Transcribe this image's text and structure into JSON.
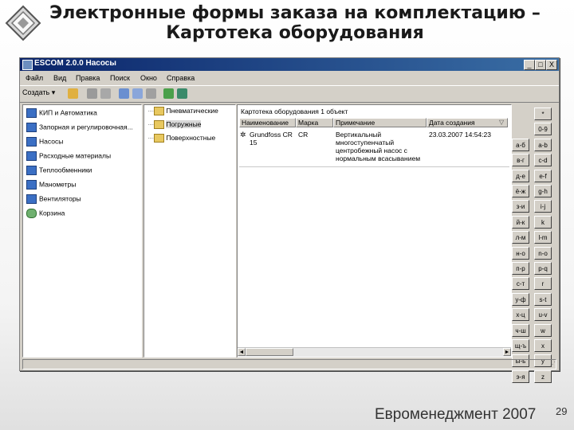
{
  "slide": {
    "title": "Электронные формы заказа на комплектацию – Картотека оборудования",
    "footer": "Евроменеджмент 2007",
    "page_number": "29"
  },
  "window": {
    "title": "ESCOM 2.0.0   Насосы",
    "controls": [
      "_",
      "□",
      "X"
    ],
    "menu": [
      "Файл",
      "Вид",
      "Правка",
      "Поиск",
      "Окно",
      "Справка"
    ],
    "toolbar": {
      "create_label": "Создать ▾",
      "icons": [
        "users-icon",
        "print-icon",
        "print-preview-icon",
        "copy-icon",
        "paste-icon",
        "delete-icon",
        "refresh-icon",
        "settings-icon"
      ]
    }
  },
  "left_nav": [
    {
      "label": "КИП и Автоматика",
      "icon": "folder-icon"
    },
    {
      "label": "Запорная и регулировочная...",
      "icon": "folder-icon"
    },
    {
      "label": "Насосы",
      "icon": "folder-icon"
    },
    {
      "label": "Расходные материалы",
      "icon": "folder-icon"
    },
    {
      "label": "Теплообменники",
      "icon": "folder-icon"
    },
    {
      "label": "Манометры",
      "icon": "folder-icon"
    },
    {
      "label": "Вентиляторы",
      "icon": "folder-icon"
    },
    {
      "label": "Корзина",
      "icon": "recycle-bin-icon"
    }
  ],
  "tree": [
    {
      "label": "Пневматические"
    },
    {
      "label": "Погружные",
      "selected": true
    },
    {
      "label": "Поверхностные"
    }
  ],
  "list": {
    "caption": "Картотека оборудования   1 объект",
    "columns": [
      "Наименование",
      "Марка",
      "Примечание",
      "Дата создания"
    ],
    "rows": [
      {
        "name": "Grundfoss CR 15",
        "brand": "CR",
        "note": "Вертикальный многоступенчатый центробежный насос с нормальным всасыванием",
        "date": "23.03.2007 14:54:23"
      }
    ]
  },
  "alphabet": [
    [
      "",
      "*"
    ],
    [
      "",
      "0-9"
    ],
    [
      "а-б",
      "a-b"
    ],
    [
      "в-г",
      "c-d"
    ],
    [
      "д-е",
      "e-f"
    ],
    [
      "ё-ж",
      "g-h"
    ],
    [
      "з-и",
      "i-j"
    ],
    [
      "й-к",
      "k"
    ],
    [
      "л-м",
      "l-m"
    ],
    [
      "н-о",
      "n-o"
    ],
    [
      "п-р",
      "p-q"
    ],
    [
      "с-т",
      "r"
    ],
    [
      "у-ф",
      "s-t"
    ],
    [
      "х-ц",
      "u-v"
    ],
    [
      "ч-ш",
      "w"
    ],
    [
      "щ-ъ",
      "x"
    ],
    [
      "ы-ь",
      "y"
    ],
    [
      "э-я",
      "z"
    ]
  ]
}
